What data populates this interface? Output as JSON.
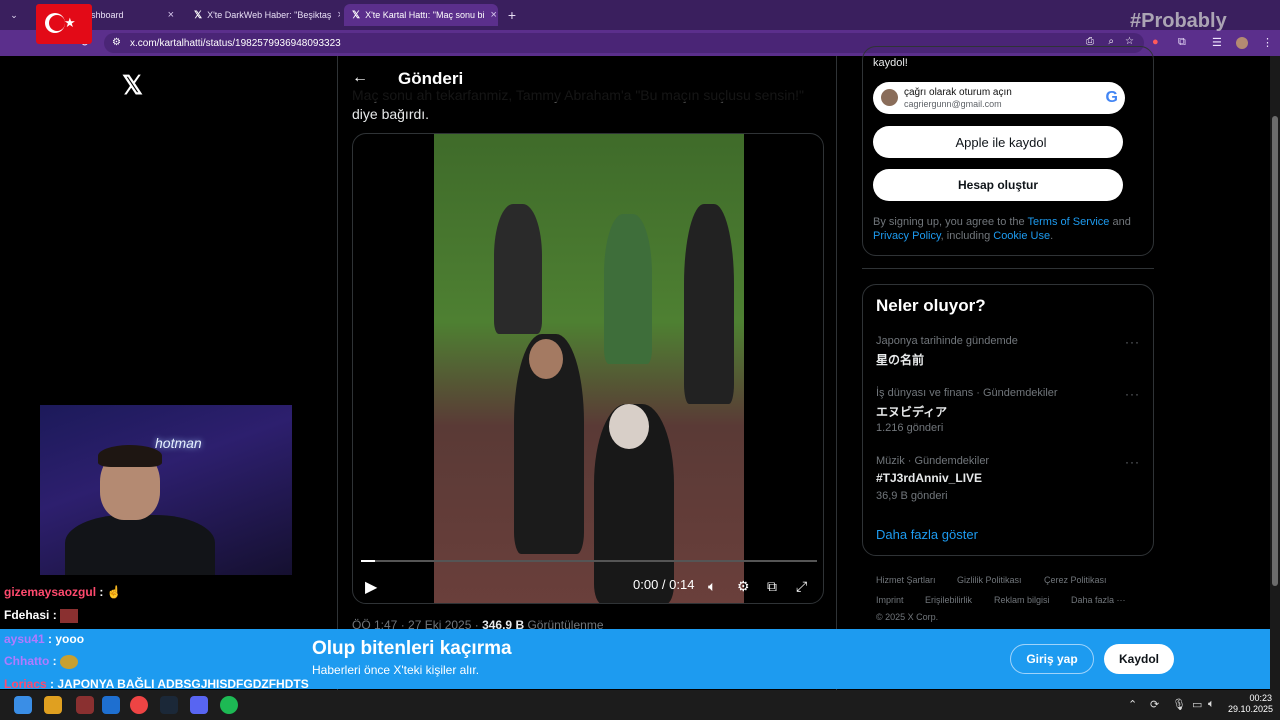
{
  "browser": {
    "tabs": [
      {
        "label": "ck Dashboard",
        "close": "×"
      },
      {
        "label": "X'te DarkWeb Haber: \"Beşiktaş",
        "close": "×"
      },
      {
        "label": "X'te Kartal Hattı: \"Maç sonu bi",
        "close": "×"
      }
    ],
    "new_tab": "+",
    "url": "x.com/kartalhatti/status/1982579936948093323"
  },
  "header": {
    "back": "←",
    "title": "Gönderi"
  },
  "post": {
    "text_faded": "Maç sonu ah tekarfanmiz, Tammy Abraham'a \"Bu maçın suçlusu sensin!\"",
    "text": "diye bağırdı.",
    "video": {
      "play": "▶",
      "time": "0:00 / 0:14",
      "progress_fraction": 0.03
    },
    "meta_time": "ÖÖ 1:47 · 27 Eki 2025 · ",
    "meta_views": "346,9 B",
    "meta_views_label": " Görüntülenme"
  },
  "signup": {
    "top_text": "kaydol!",
    "google_line1": "çağrı olarak oturum açın",
    "google_line2": "cagriergunn@gmail.com",
    "google_logo": "G",
    "apple_label": "Apple ile kaydol",
    "create_label": "Hesap oluştur",
    "terms_pre": "By signing up, you agree to the ",
    "terms_link": "Terms of Service",
    "terms_and": " and ",
    "privacy_link": "Privacy Policy",
    "terms_including": ", including ",
    "cookie_link": "Cookie Use",
    "terms_end": "."
  },
  "trends": {
    "title": "Neler oluyor?",
    "items": [
      {
        "category": "Japonya tarihinde gündemde",
        "name": "星の名前",
        "count": ""
      },
      {
        "category": "İş dünyası ve finans · Gündemdekiler",
        "name": "エヌビディア",
        "count": "1.216 gönderi"
      },
      {
        "category": "Müzik · Gündemdekiler",
        "name": "#TJ3rdAnniv_LIVE",
        "count": "36,9 B gönderi"
      }
    ],
    "more_dots": "···",
    "show_more": "Daha fazla göster"
  },
  "footer": {
    "links": [
      "Hizmet Şartları",
      "Gizlilik Politikası",
      "Çerez Politikası",
      "Imprint",
      "Erişilebilirlik",
      "Reklam bilgisi",
      "Daha fazla ···"
    ],
    "copyright": "© 2025 X Corp."
  },
  "banner": {
    "title": "Olup bitenleri kaçırma",
    "subtitle": "Haberleri önce X'teki kişiler alır.",
    "login": "Giriş yap",
    "signup": "Kaydol"
  },
  "stream": {
    "watermark": "#Probably",
    "neon_sign": "hotman",
    "chat": [
      {
        "user": "gizemaysaozgul",
        "sep": " : ",
        "msg": "☝",
        "color": "#ff4a6e"
      },
      {
        "user": "Fdehasi",
        "sep": " : ",
        "msg": "",
        "color": "#ffffff"
      },
      {
        "user": "aysu41",
        "sep": " : ",
        "msg": "yooo",
        "color": "#b07bff"
      },
      {
        "user": "Chhatto",
        "sep": " : ",
        "msg": "",
        "color": "#b07bff"
      },
      {
        "user": "Loriacs",
        "sep": " : ",
        "msg": "JAPONYA BAĞLI ADBSGJHISDFGDZFHDTS",
        "color": "#ff4a6e"
      }
    ]
  },
  "taskbar": {
    "time": "00:23",
    "date": "29.10.2025"
  },
  "colors": {
    "accent": "#1d9bf0",
    "browser_purple": "#5b2f8c",
    "tab_bar": "#3a1f5e"
  }
}
